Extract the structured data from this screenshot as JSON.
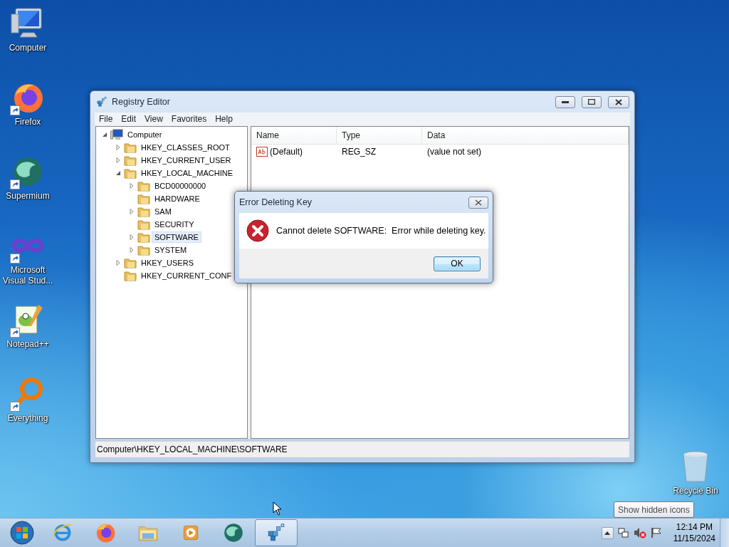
{
  "desktop_icons": [
    {
      "label": "Computer",
      "kind": "computer",
      "shortcut": false
    },
    {
      "label": "Firefox",
      "kind": "firefox",
      "shortcut": true
    },
    {
      "label": "Supermium",
      "kind": "supermium",
      "shortcut": true
    },
    {
      "label": "Microsoft Visual Stud...",
      "kind": "visualstudio",
      "shortcut": true
    },
    {
      "label": "Notepad++",
      "kind": "notepad",
      "shortcut": true
    },
    {
      "label": "Everything",
      "kind": "everything",
      "shortcut": true
    }
  ],
  "recycle_bin": {
    "label": "Recycle Bin"
  },
  "registry_editor": {
    "title": "Registry Editor",
    "menu": [
      "File",
      "Edit",
      "View",
      "Favorites",
      "Help"
    ],
    "tree": [
      {
        "label": "Computer",
        "kind": "computer",
        "expanded": true,
        "selected": false,
        "children": [
          {
            "label": "HKEY_CLASSES_ROOT",
            "kind": "folder",
            "expanded": false,
            "selected": false
          },
          {
            "label": "HKEY_CURRENT_USER",
            "kind": "folder",
            "expanded": false,
            "selected": false
          },
          {
            "label": "HKEY_LOCAL_MACHINE",
            "kind": "folder",
            "expanded": true,
            "selected": false,
            "children": [
              {
                "label": "BCD00000000",
                "kind": "folder",
                "expanded": false,
                "selected": false
              },
              {
                "label": "HARDWARE",
                "kind": "folder",
                "selected": false
              },
              {
                "label": "SAM",
                "kind": "folder",
                "expanded": false,
                "selected": false
              },
              {
                "label": "SECURITY",
                "kind": "folder",
                "selected": false
              },
              {
                "label": "SOFTWARE",
                "kind": "folder",
                "expanded": false,
                "selected": true
              },
              {
                "label": "SYSTEM",
                "kind": "folder",
                "expanded": false,
                "selected": false
              }
            ]
          },
          {
            "label": "HKEY_USERS",
            "kind": "folder",
            "expanded": false,
            "selected": false
          },
          {
            "label": "HKEY_CURRENT_CONF",
            "kind": "folder",
            "selected": false
          }
        ]
      }
    ],
    "columns": [
      "Name",
      "Type",
      "Data"
    ],
    "rows": [
      {
        "name": "(Default)",
        "type": "REG_SZ",
        "data": "(value not set)"
      }
    ],
    "status_bar": "Computer\\HKEY_LOCAL_MACHINE\\SOFTWARE"
  },
  "dialog": {
    "title": "Error Deleting Key",
    "message": "Cannot delete SOFTWARE:  Error while deleting key.",
    "button": "OK"
  },
  "tooltip": "Show hidden icons",
  "taskbar": {
    "apps": [
      {
        "kind": "ie",
        "selected": false
      },
      {
        "kind": "firefox",
        "selected": false
      },
      {
        "kind": "explorer",
        "selected": false
      },
      {
        "kind": "media",
        "selected": false
      },
      {
        "kind": "supermium",
        "selected": false
      },
      {
        "kind": "regedit",
        "selected": true
      }
    ],
    "clock": {
      "time": "12:14 PM",
      "date": "11/15/2024"
    }
  }
}
